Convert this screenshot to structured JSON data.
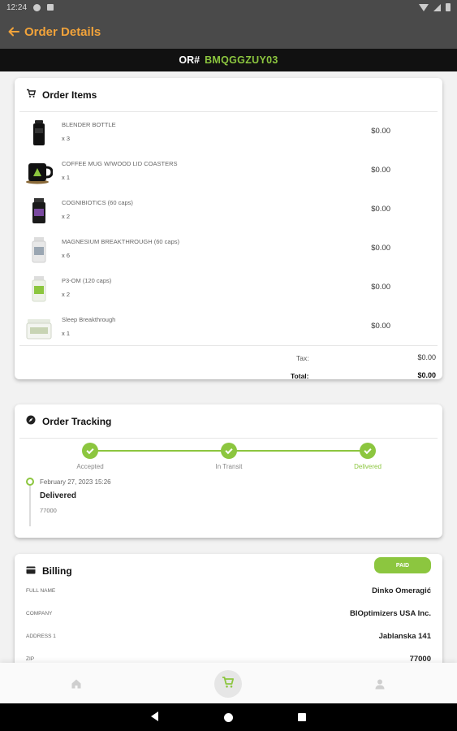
{
  "status_bar": {
    "time": "12:24"
  },
  "app_bar": {
    "back_icon": "arrow-left-icon",
    "title": "Order Details"
  },
  "order_bar": {
    "prefix": "OR#",
    "number": "BMQGGZUY03"
  },
  "order_items": {
    "title": "Order Items",
    "items": [
      {
        "name": "BLENDER BOTTLE",
        "qty": "x 3",
        "price": "$0.00",
        "icon": "blender-bottle-image"
      },
      {
        "name": "COFFEE MUG W/WOOD LID COASTERS",
        "qty": "x 1",
        "price": "$0.00",
        "icon": "coffee-mug-image"
      },
      {
        "name": "COGNIBIOTICS (60 caps)",
        "qty": "x 2",
        "price": "$0.00",
        "icon": "cognibiotics-image"
      },
      {
        "name": "MAGNESIUM BREAKTHROUGH (60 caps)",
        "qty": "x 6",
        "price": "$0.00",
        "icon": "magnesium-image"
      },
      {
        "name": "P3-OM (120 caps)",
        "qty": "x 2",
        "price": "$0.00",
        "icon": "p3om-image"
      },
      {
        "name": "Sleep Breakthrough",
        "qty": "x 1",
        "price": "$0.00",
        "icon": "sleep-breakthrough-image"
      }
    ],
    "tax_label": "Tax:",
    "tax_value": "$0.00",
    "total_label": "Total:",
    "total_value": "$0.00"
  },
  "tracking": {
    "title": "Order Tracking",
    "steps": [
      {
        "label": "Accepted",
        "done": true
      },
      {
        "label": "In Transit",
        "done": true
      },
      {
        "label": "Delivered",
        "done": true,
        "active": true
      }
    ],
    "event": {
      "date": "February 27, 2023 15:26",
      "status": "Delivered",
      "code": "77000"
    }
  },
  "billing": {
    "title": "Billing",
    "badge": "PAID",
    "rows": [
      {
        "label": "FULL NAME",
        "value": "Dinko Omeragić"
      },
      {
        "label": "COMPANY",
        "value": "BIOptimizers USA Inc."
      },
      {
        "label": "ADDRESS 1",
        "value": "Jablanska 141"
      },
      {
        "label": "ZIP",
        "value": "77000"
      }
    ]
  },
  "bottom_nav": {
    "home": "home-icon",
    "cart": "cart-icon",
    "profile": "person-icon"
  },
  "colors": {
    "accent_orange": "#f2a33a",
    "accent_green": "#8cc63f",
    "app_bar": "#4a4a4a"
  }
}
